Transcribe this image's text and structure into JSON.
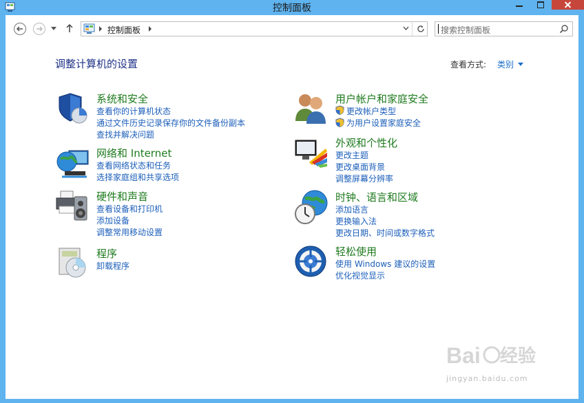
{
  "window": {
    "title": "控制面板"
  },
  "nav": {
    "address_label": "控制面板",
    "search_placeholder": "搜索控制面板"
  },
  "main": {
    "heading": "调整计算机的设置",
    "view_by_label": "查看方式:",
    "view_by_value": "类别"
  },
  "categories": {
    "system": {
      "title": "系统和安全",
      "icon": "shield-pie-icon",
      "links": [
        "查看你的计算机状态",
        "通过文件历史记录保存你的文件备份副本",
        "查找并解决问题"
      ]
    },
    "network": {
      "title": "网络和 Internet",
      "icon": "globe-network-icon",
      "links": [
        "查看网络状态和任务",
        "选择家庭组和共享选项"
      ]
    },
    "hardware": {
      "title": "硬件和声音",
      "icon": "printer-speaker-icon",
      "links": [
        "查看设备和打印机",
        "添加设备",
        "调整常用移动设置"
      ]
    },
    "programs": {
      "title": "程序",
      "icon": "programs-disc-icon",
      "links": [
        "卸载程序"
      ]
    },
    "users": {
      "title": "用户帐户和家庭安全",
      "icon": "users-icon",
      "links": [
        "更改帐户类型",
        "为用户设置家庭安全"
      ]
    },
    "appearance": {
      "title": "外观和个性化",
      "icon": "monitor-palette-icon",
      "links": [
        "更改主题",
        "更改桌面背景",
        "调整屏幕分辨率"
      ]
    },
    "clock": {
      "title": "时钟、语言和区域",
      "icon": "clock-globe-icon",
      "links": [
        "添加语言",
        "更换输入法",
        "更改日期、时间或数字格式"
      ]
    },
    "ease": {
      "title": "轻松使用",
      "icon": "ease-of-access-icon",
      "links": [
        "使用 Windows 建议的设置",
        "优化视觉显示"
      ]
    }
  },
  "watermark": {
    "text": "jingyan.baidu.com"
  },
  "colors": {
    "titlebar": "#5fb3ef",
    "category_title": "#1e7a1e",
    "link": "#1c5fba",
    "heading": "#1e3287",
    "close_button": "#c7463b"
  }
}
